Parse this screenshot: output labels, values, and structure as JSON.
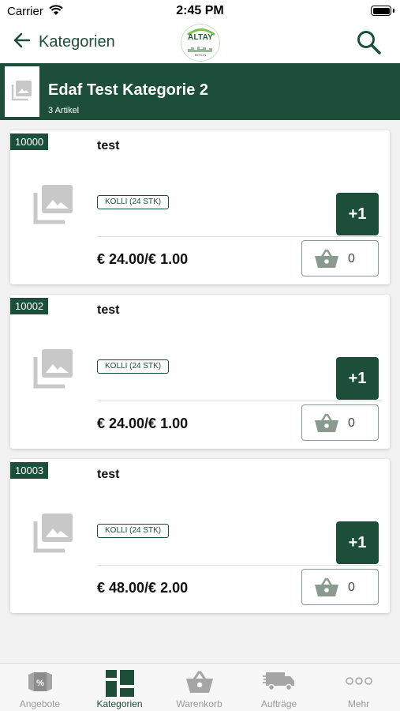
{
  "status_bar": {
    "carrier": "Carrier",
    "time": "2:45 PM"
  },
  "nav": {
    "back_label": "Kategorien",
    "logo_text": "ALTAY",
    "logo_sub": "BERLIN"
  },
  "category": {
    "title": "Edaf Test Kategorie 2",
    "count": "3 Artikel"
  },
  "products": [
    {
      "article_no": "10000",
      "name": "test",
      "pack": "KOLLI (24 STK)",
      "add_label": "+1",
      "price": "€ 24.00/€ 1.00",
      "cart_qty": "0"
    },
    {
      "article_no": "10002",
      "name": "test",
      "pack": "KOLLI (24 STK)",
      "add_label": "+1",
      "price": "€ 24.00/€ 1.00",
      "cart_qty": "0"
    },
    {
      "article_no": "10003",
      "name": "test",
      "pack": "KOLLI (24 STK)",
      "add_label": "+1",
      "price": "€ 48.00/€ 2.00",
      "cart_qty": "0"
    }
  ],
  "tabs": [
    {
      "label": "Angebote",
      "icon": "offers-icon"
    },
    {
      "label": "Kategorien",
      "icon": "grid-icon",
      "active": true
    },
    {
      "label": "Warenkorb",
      "icon": "basket-icon"
    },
    {
      "label": "Aufträge",
      "icon": "truck-icon"
    },
    {
      "label": "Mehr",
      "icon": "more-icon"
    }
  ],
  "colors": {
    "primary": "#1d4e3a",
    "inactive": "#9a9a9a",
    "background": "#f2f2f2"
  }
}
